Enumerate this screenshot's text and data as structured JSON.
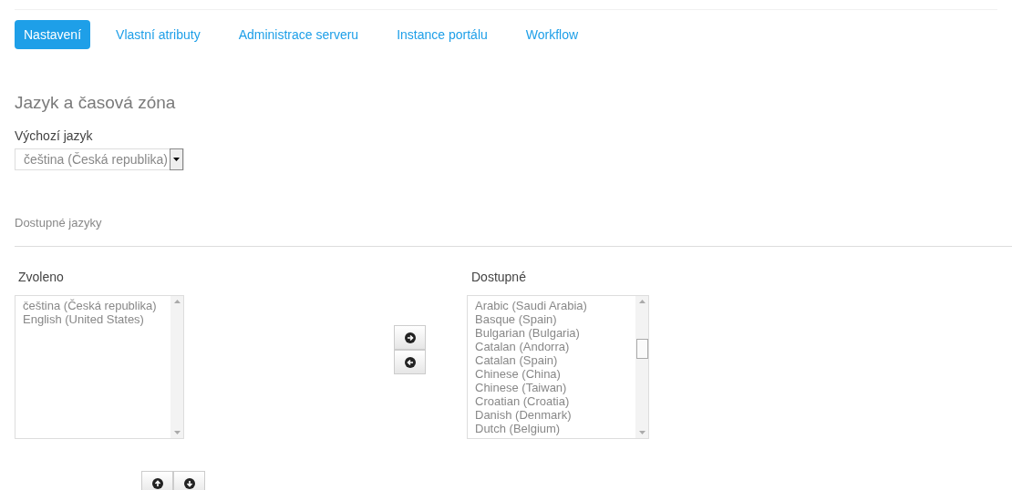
{
  "tabs": [
    {
      "label": "Nastavení",
      "selected": true
    },
    {
      "label": "Vlastní atributy",
      "selected": false
    },
    {
      "label": "Administrace serveru",
      "selected": false
    },
    {
      "label": "Instance portálu",
      "selected": false
    },
    {
      "label": "Workflow",
      "selected": false
    }
  ],
  "section_title": "Jazyk a časová zóna",
  "default_language": {
    "label": "Výchozí jazyk",
    "value": "čeština (Česká republika)"
  },
  "available_languages_title": "Dostupné jazyky",
  "selected_list": {
    "label": "Zvoleno",
    "items": [
      "čeština (Česká republika)",
      "English (United States)"
    ]
  },
  "available_list": {
    "label": "Dostupné",
    "items": [
      "Arabic (Saudi Arabia)",
      "Basque (Spain)",
      "Bulgarian (Bulgaria)",
      "Catalan (Andorra)",
      "Catalan (Spain)",
      "Chinese (China)",
      "Chinese (Taiwan)",
      "Croatian (Croatia)",
      "Danish (Denmark)",
      "Dutch (Belgium)"
    ]
  }
}
